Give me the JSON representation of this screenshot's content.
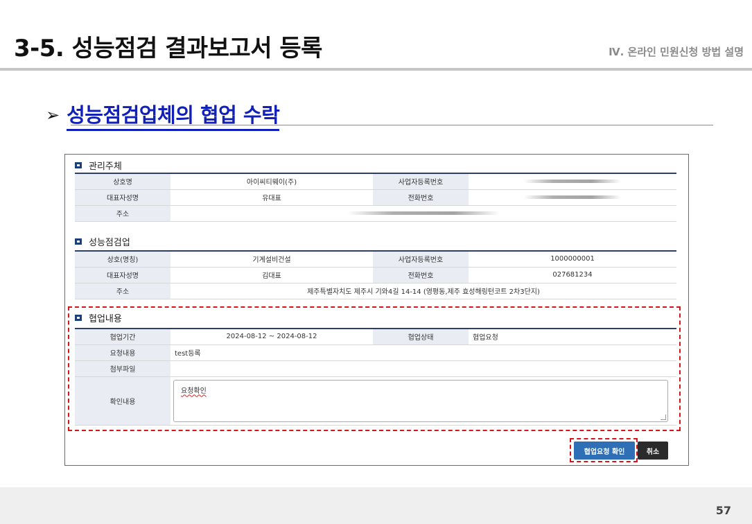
{
  "slide": {
    "title": "3-5. 성능점검 결과보고서 등록",
    "section": "Ⅳ. 온라인 민원신청 방법 설명",
    "subtitle_arrow": "➢",
    "subtitle": "성능점검업체의 협업 수락",
    "page_number": "57"
  },
  "management": {
    "heading": "관리주체",
    "rows": [
      {
        "label1": "상호명",
        "value1": "아이씨티웨이(주)",
        "label2": "사업자등록번호",
        "value2": ""
      },
      {
        "label1": "대표자성명",
        "value1": "유대표",
        "label2": "전화번호",
        "value2": ""
      },
      {
        "label1": "주소",
        "value1": ""
      }
    ]
  },
  "inspector": {
    "heading": "성능점검업",
    "rows": [
      {
        "label1": "상호(명칭)",
        "value1": "기계설비건설",
        "label2": "사업자등록번호",
        "value2": "1000000001"
      },
      {
        "label1": "대표자성명",
        "value1": "김대표",
        "label2": "전화번호",
        "value2": "027681234"
      },
      {
        "label1": "주소",
        "value1": "제주특별자치도 제주시 기와4길 14-14 (영평동,제주 효성해링턴코트 2차3단지)"
      }
    ]
  },
  "cooperation": {
    "heading": "협업내용",
    "period_label": "협업기간",
    "period_value": "2024-08-12 ~ 2024-08-12",
    "status_label": "협업상태",
    "status_value": "협업요청",
    "request_label": "요청내용",
    "request_value": "test등록",
    "attachment_label": "첨부파일",
    "attachment_value": "",
    "confirm_label": "확인내용",
    "confirm_text": "요청확인"
  },
  "buttons": {
    "confirm": "협업요청 확인",
    "cancel": "취소"
  },
  "colors": {
    "subtitle": "#1020b8",
    "highlight": "#d8141b",
    "confirm_button": "#2f6fb5",
    "cancel_button": "#2b2b2b"
  }
}
